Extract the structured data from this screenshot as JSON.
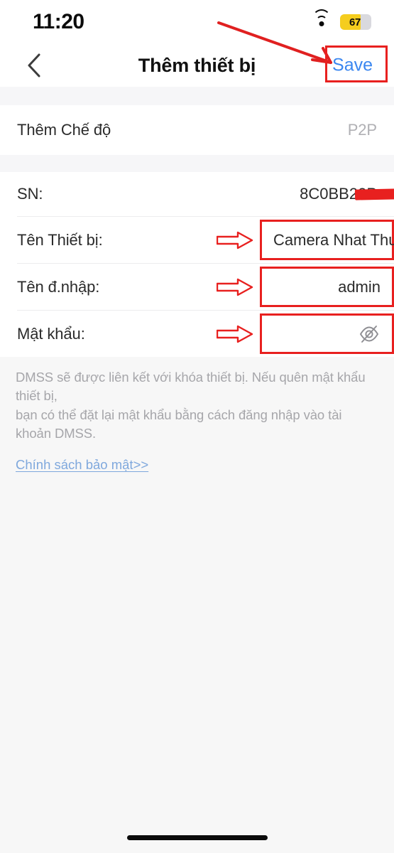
{
  "status_bar": {
    "time": "11:20",
    "battery_percent": "67",
    "battery_level": 67,
    "battery_color": "#f5cd1e",
    "cellular_icon": "cellular-signal-icon",
    "wifi_icon": "wifi-icon",
    "battery_icon": "battery-icon"
  },
  "nav": {
    "back_icon": "chevron-left-icon",
    "title": "Thêm thiết bị",
    "save_label": "Save",
    "save_color": "#3b87f0"
  },
  "mode_row": {
    "label": "Thêm Chế độ",
    "value": "P2P"
  },
  "fields": {
    "sn": {
      "label": "SN:",
      "value": "8C0BB22P",
      "redacted": true
    },
    "device_name": {
      "label": "Tên Thiết bị:",
      "value": "Camera Nhat Thuc",
      "placeholder": "Tên Thiết bị"
    },
    "username": {
      "label": "Tên đ.nhập:",
      "value": "admin",
      "placeholder": "Tên đ.nhập"
    },
    "password": {
      "label": "Mật khẩu:",
      "value": "",
      "placeholder": "",
      "toggle_icon": "eye-slash-icon"
    }
  },
  "helper": {
    "line1": "DMSS sẽ được liên kết với khóa thiết bị. Nếu quên mật khẩu thiết bị,",
    "line2": "bạn có thể đặt lại mật khẩu bằng cách đăng nhập vào tài khoản DMSS.",
    "policy_link": "Chính sách bảo mật>>"
  },
  "annotations": {
    "accent_color": "#e8201f",
    "arrow_to_save": "long-diagonal-arrow",
    "arrow_device_name": "hollow-right-arrow",
    "arrow_username": "hollow-right-arrow",
    "arrow_password": "hollow-right-arrow",
    "box_save": "highlight-box",
    "box_device_name": "highlight-box",
    "box_username": "highlight-box",
    "box_password": "highlight-box"
  }
}
